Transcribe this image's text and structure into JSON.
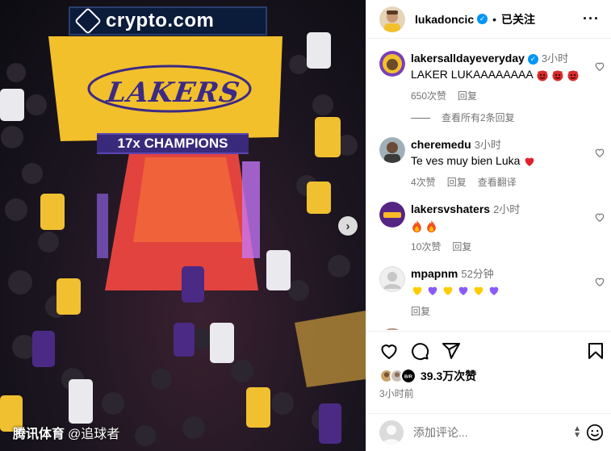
{
  "photo": {
    "sponsor_text": "crypto.com",
    "court_logo_text": "LAKERS",
    "banner_text": "17x CHAMPIONS",
    "next_arrow": "›",
    "watermark_brand": "腾讯体育",
    "watermark_handle": "@追球者"
  },
  "header": {
    "username": "lukadoncic",
    "verified_mark": "✓",
    "separator": "•",
    "follow_state": "已关注",
    "more_icon": "···"
  },
  "comments": [
    {
      "user": "lakersalldayeveryday",
      "verified": true,
      "time": "3小时",
      "text": "LAKER LUKAAAAAAAA",
      "emojis": [
        "red-devil",
        "red-devil",
        "red-devil"
      ],
      "likes": "650次赞",
      "reply": "回复",
      "view_replies": "查看所有2条回复"
    },
    {
      "user": "cheremedu",
      "time": "3小时",
      "text": "Te ves muy bien Luka",
      "emojis": [
        "red-heart"
      ],
      "likes": "4次赞",
      "reply": "回复",
      "translate": "查看翻译"
    },
    {
      "user": "lakersvshaters",
      "time": "2小时",
      "text": "",
      "emojis": [
        "fire",
        "fire"
      ],
      "likes": "10次赞",
      "reply": "回复"
    },
    {
      "user": "mpapnm",
      "time": "52分钟",
      "text": "",
      "emojis": [
        "yellow-heart",
        "purple-heart",
        "yellow-heart",
        "purple-heart",
        "yellow-heart",
        "purple-heart"
      ],
      "reply": "回复"
    }
  ],
  "actions": {
    "like_icon": "heart-icon",
    "comment_icon": "comment-icon",
    "share_icon": "share-icon",
    "save_icon": "bookmark-icon"
  },
  "likes": {
    "count_text": "39.3万次赞",
    "liker_badge": "B/R"
  },
  "post_time": "3小时前",
  "comment_box": {
    "placeholder": "添加评论..."
  },
  "colors": {
    "verified": "#0095f6",
    "muted": "#737373",
    "lakers_purple": "#552583",
    "lakers_gold": "#fdb927"
  }
}
